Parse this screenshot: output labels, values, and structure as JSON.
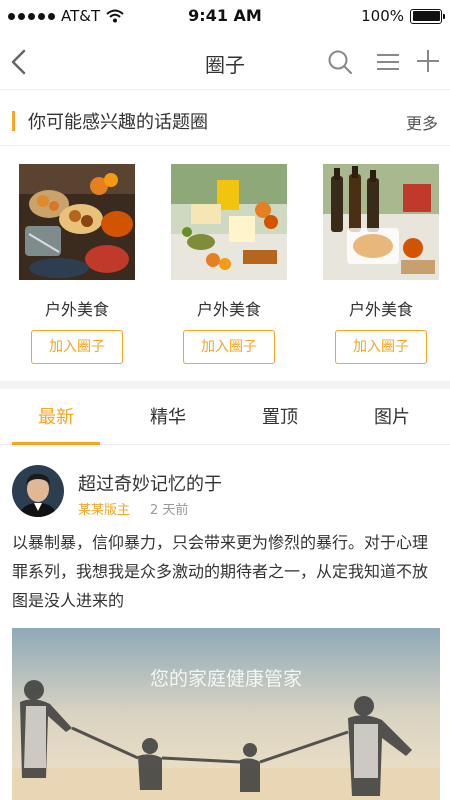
{
  "status_bar": {
    "carrier": "AT&T",
    "time": "9:41 AM",
    "battery": "100%"
  },
  "nav": {
    "title": "圈子",
    "icons": [
      "back-icon",
      "search-icon",
      "menu-icon",
      "add-icon"
    ]
  },
  "section": {
    "title": "你可能感兴趣的话题圈",
    "more": "更多"
  },
  "circles": [
    {
      "name": "户外美食",
      "join_label": "加入圈子"
    },
    {
      "name": "户外美食",
      "join_label": "加入圈子"
    },
    {
      "name": "户外美食",
      "join_label": "加入圈子"
    }
  ],
  "tabs": [
    {
      "label": "最新",
      "active": true
    },
    {
      "label": "精华",
      "active": false
    },
    {
      "label": "置顶",
      "active": false
    },
    {
      "label": "图片",
      "active": false
    }
  ],
  "post": {
    "author": "超过奇妙记忆的于",
    "role": "某某版主",
    "time": "2 天前",
    "body": "以暴制暴，信仰暴力，只会带来更为惨烈的暴行。对于心理罪系列，我想我是众多激动的期待者之一，从定我知道不放图是没人进来的",
    "image_caption": "您的家庭健康管家"
  },
  "colors": {
    "accent": "#f5a623",
    "text": "#333333",
    "muted": "#999999"
  }
}
